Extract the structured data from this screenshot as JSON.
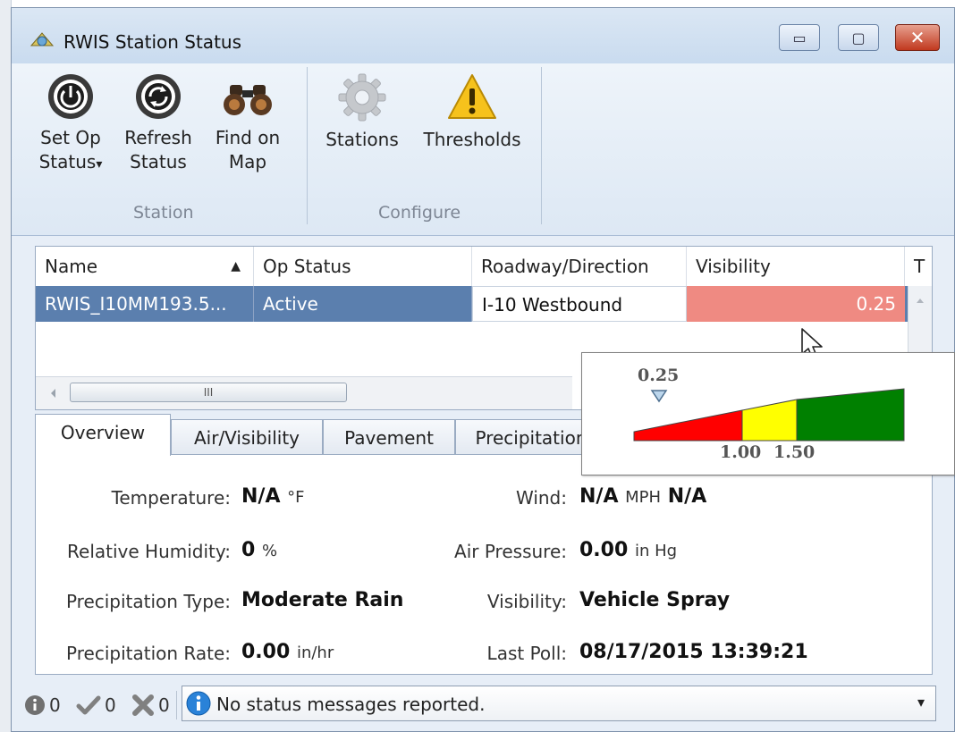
{
  "window": {
    "title": "RWIS Station Status",
    "controls": {
      "minimize": "▭",
      "maximize": "▢",
      "close": "✕"
    }
  },
  "ribbon": {
    "groups": [
      {
        "label": "Station",
        "buttons": [
          {
            "line1": "Set Op",
            "line2": "Status",
            "dropdown": "▾",
            "icon": "power-icon"
          },
          {
            "line1": "Refresh",
            "line2": "Status",
            "icon": "refresh-icon"
          },
          {
            "line1": "Find on",
            "line2": "Map",
            "icon": "binoculars-icon"
          }
        ]
      },
      {
        "label": "Configure",
        "buttons": [
          {
            "line1": "Stations",
            "icon": "gear-icon"
          },
          {
            "line1": "Thresholds",
            "icon": "warning-icon"
          }
        ]
      }
    ]
  },
  "grid": {
    "columns": [
      "Name",
      "Op Status",
      "Roadway/Direction",
      "Visibility",
      "T"
    ],
    "sort_indicator": "▲",
    "rows": [
      {
        "name": "RWIS_I10MM193.5...",
        "op_status": "Active",
        "roadway": "I-10 Westbound",
        "visibility": "0.25"
      }
    ],
    "hscroll_grip": "III",
    "alert_color": "#ef8a82",
    "selection_color": "#5b7fae"
  },
  "threshold_popup": {
    "marker_label": "0.25",
    "threshold_labels": [
      "1.00",
      "1.50"
    ],
    "colors": {
      "low": "#ff0000",
      "mid": "#ffff00",
      "high": "#008000"
    }
  },
  "tabs": [
    "Overview",
    "Air/Visibility",
    "Pavement",
    "Precipitation"
  ],
  "overview": {
    "temperature": {
      "label": "Temperature:",
      "value": "N/A",
      "unit": "°F"
    },
    "wind": {
      "label": "Wind:",
      "value": "N/A",
      "unit": "MPH",
      "direction": "N/A"
    },
    "humidity": {
      "label": "Relative Humidity:",
      "value": "0",
      "unit": "%"
    },
    "air_pressure": {
      "label": "Air Pressure:",
      "value": "0.00",
      "unit": "in Hg"
    },
    "precip_type": {
      "label": "Precipitation Type:",
      "value": "Moderate Rain"
    },
    "visibility": {
      "label": "Visibility:",
      "value": "Vehicle Spray"
    },
    "precip_rate": {
      "label": "Precipitation Rate:",
      "value": "0.00",
      "unit": "in/hr"
    },
    "last_poll": {
      "label": "Last Poll:",
      "value": "08/17/2015 13:39:21"
    }
  },
  "statusbar": {
    "info_count": "0",
    "ok_count": "0",
    "error_count": "0",
    "message": "No status messages reported.",
    "dropdown": "▾"
  }
}
